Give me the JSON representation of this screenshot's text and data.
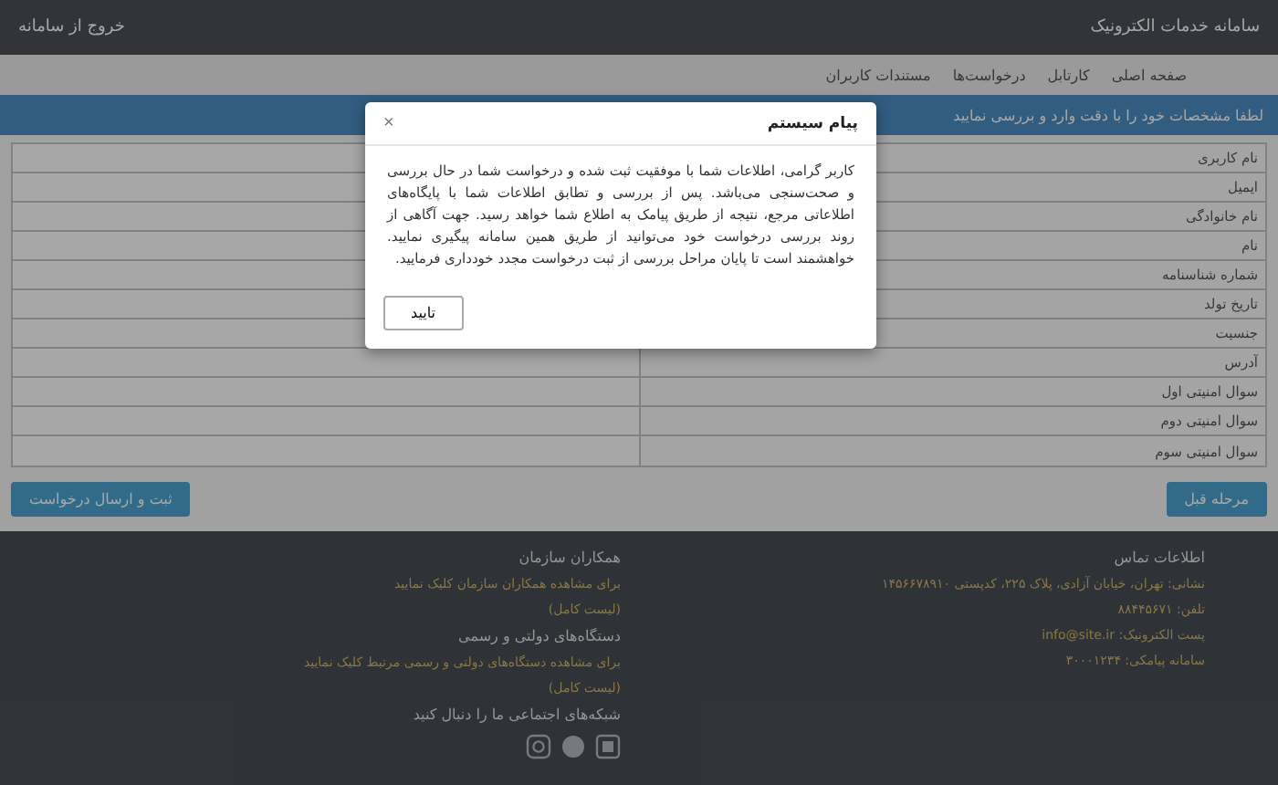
{
  "header": {
    "site_title": "سامانه خدمات الکترونیک",
    "logout": "خروج از سامانه"
  },
  "nav": [
    {
      "label": "صفحه اصلی",
      "selected": false
    },
    {
      "label": "کارتابل",
      "selected": false
    },
    {
      "label": "درخواست‌ها",
      "selected": false
    },
    {
      "label": "مستندات کاربران",
      "selected": false
    }
  ],
  "banner": "لطفا مشخصات خود را با دقت وارد و بررسی نمایید",
  "form": {
    "rows": [
      {
        "label": "نام کاربری"
      },
      {
        "label": "ایمیل"
      },
      {
        "label": "نام خانوادگی"
      },
      {
        "label": "نام"
      },
      {
        "label": "شماره شناسنامه"
      },
      {
        "label": "تاریخ تولد"
      },
      {
        "label": "جنسیت"
      },
      {
        "label": "آدرس"
      },
      {
        "label": "سوال امنیتی اول"
      },
      {
        "label": "سوال امنیتی دوم"
      },
      {
        "label": "سوال امنیتی سوم"
      }
    ]
  },
  "actions": {
    "back": "مرحله قبل",
    "submit": "ثبت و ارسال درخواست"
  },
  "footer": {
    "contact": {
      "title": "اطلاعات تماس",
      "lines": [
        "نشانی: تهران، خیابان آزادی، پلاک ۲۲۵، کدپستی ۱۴۵۶۶۷۸۹۱۰",
        "تلفن: ۸۸۴۴۵۶۷۱",
        "پست الکترونیک: info@site.ir",
        "سامانه پیامکی: ۳۰۰۰۱۲۳۴"
      ]
    },
    "partners": {
      "title": "همکاران سازمان",
      "lines": [
        "برای مشاهده همکاران سازمان کلیک نمایید",
        "(لیست کامل)"
      ]
    },
    "agencies": {
      "title": "دستگاه‌های دولتی و رسمی",
      "lines": [
        "برای مشاهده دستگاه‌های دولتی و رسمی مرتبط کلیک نمایید",
        "(لیست کامل)"
      ]
    },
    "social_title": "شبکه‌های اجتماعی ما را دنبال کنید"
  },
  "modal": {
    "title": "پیام سیستم",
    "close": "×",
    "message": "کاربر گرامی، اطلاعات شما با موفقیت ثبت شده و درخواست شما در حال بررسی و صحت‌سنجی می‌باشد. پس از بررسی و تطابق اطلاعات شما با پایگاه‌های اطلاعاتی مرجع، نتیجه از طریق پیامک به اطلاع شما خواهد رسید. جهت آگاهی از روند بررسی درخواست خود می‌توانید از طریق همین سامانه پیگیری نمایید. خواهشمند است تا پایان مراحل بررسی از ثبت درخواست مجدد خودداری فرمایید.",
    "ok": "تایید"
  }
}
